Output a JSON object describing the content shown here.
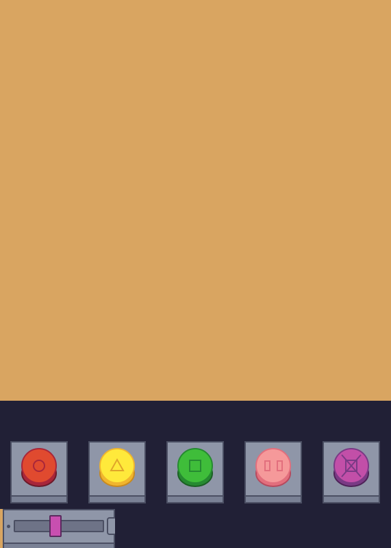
{
  "colors": {
    "play_area_bg": "#d9a561",
    "panel_bg": "#212036",
    "button_base": "#8f96a8",
    "button_border": "#4b4f63"
  },
  "buttons": [
    {
      "name": "circle",
      "icon": "circle-icon",
      "color": "#e04a2f",
      "rim": "#a8263a"
    },
    {
      "name": "triangle",
      "icon": "triangle-icon",
      "color": "#ffe93b",
      "rim": "#f0b52e"
    },
    {
      "name": "square",
      "icon": "square-icon",
      "color": "#3fbd3a",
      "rim": "#268a31"
    },
    {
      "name": "pause",
      "icon": "pause-icon",
      "color": "#f5999a",
      "rim": "#e26f7d"
    },
    {
      "name": "cross",
      "icon": "cross-icon",
      "color": "#c24fa8",
      "rim": "#7a3a85"
    }
  ],
  "slider": {
    "value_fraction": 0.46,
    "thumb_color": "#c84fb0"
  }
}
